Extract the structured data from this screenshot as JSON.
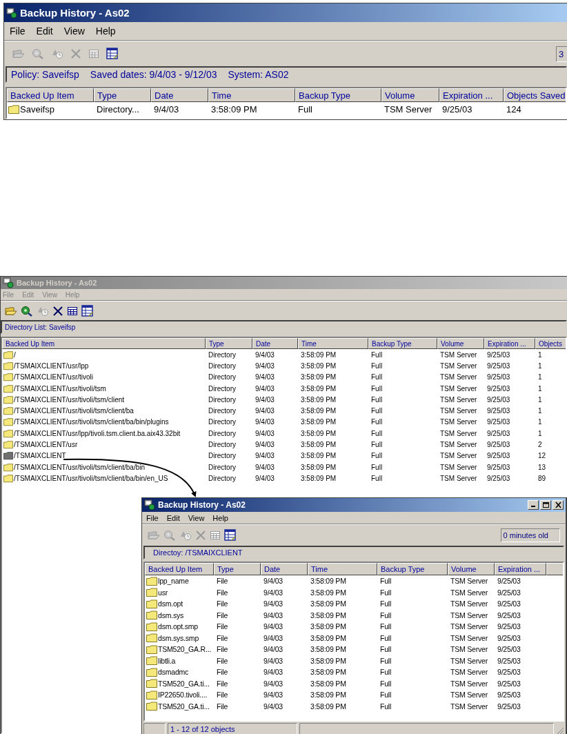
{
  "windows": [
    {
      "title": "Backup History - As02",
      "active": true,
      "has_controls": false,
      "menu": [
        "File",
        "Edit",
        "View",
        "Help"
      ],
      "toolbar": [
        {
          "kind": "open",
          "disabled": true
        },
        {
          "kind": "find",
          "disabled": true
        },
        {
          "kind": "schedule",
          "disabled": true
        },
        {
          "kind": "delete",
          "disabled": true
        },
        {
          "kind": "grid",
          "disabled": true
        },
        {
          "kind": "details",
          "disabled": false
        }
      ],
      "age_field": "3",
      "info": [
        "Policy: Saveifsp",
        "Saved dates: 9/4/03 - 9/12/03",
        "System: AS02"
      ],
      "columns": [
        "Backed Up Item",
        "Type",
        "Date",
        "Time",
        "Backup Type",
        "Volume",
        "Expiration ...",
        "Objects Saved"
      ],
      "rows": [
        {
          "selected": false,
          "cells": [
            "Saveifsp",
            "Directory...",
            "9/4/03",
            "3:58:09 PM",
            "Full",
            "TSM Server",
            "9/25/03",
            "124"
          ]
        }
      ]
    },
    {
      "title": "Backup History - As02",
      "active": false,
      "has_controls": false,
      "menu": [
        "File",
        "Edit",
        "View",
        "Help"
      ],
      "toolbar": [
        {
          "kind": "open",
          "disabled": false
        },
        {
          "kind": "find",
          "disabled": false
        },
        {
          "kind": "schedule",
          "disabled": true
        },
        {
          "kind": "delete",
          "disabled": false
        },
        {
          "kind": "grid",
          "disabled": false
        },
        {
          "kind": "details",
          "disabled": false
        }
      ],
      "info": [
        "Directory List: Saveifsp"
      ],
      "columns": [
        "Backed Up Item",
        "Type",
        "Date",
        "Time",
        "Backup Type",
        "Volume",
        "Expiration ...",
        "Objects"
      ],
      "rows": [
        {
          "selected": false,
          "cells": [
            "/",
            "Directory",
            "9/4/03",
            "3:58:09 PM",
            "Full",
            "TSM Server",
            "9/25/03",
            "1"
          ]
        },
        {
          "selected": false,
          "cells": [
            "/TSMAIXCLIENT/usr/lpp",
            "Directory",
            "9/4/03",
            "3:58:09 PM",
            "Full",
            "TSM Server",
            "9/25/03",
            "1"
          ]
        },
        {
          "selected": false,
          "cells": [
            "/TSMAIXCLIENT/usr/tivoli",
            "Directory",
            "9/4/03",
            "3:58:09 PM",
            "Full",
            "TSM Server",
            "9/25/03",
            "1"
          ]
        },
        {
          "selected": false,
          "cells": [
            "/TSMAIXCLIENT/usr/tivoli/tsm",
            "Directory",
            "9/4/03",
            "3:58:09 PM",
            "Full",
            "TSM Server",
            "9/25/03",
            "1"
          ]
        },
        {
          "selected": false,
          "cells": [
            "/TSMAIXCLIENT/usr/tivoli/tsm/client",
            "Directory",
            "9/4/03",
            "3:58:09 PM",
            "Full",
            "TSM Server",
            "9/25/03",
            "1"
          ]
        },
        {
          "selected": false,
          "cells": [
            "/TSMAIXCLIENT/usr/tivoli/tsm/client/ba",
            "Directory",
            "9/4/03",
            "3:58:09 PM",
            "Full",
            "TSM Server",
            "9/25/03",
            "1"
          ]
        },
        {
          "selected": false,
          "cells": [
            "/TSMAIXCLIENT/usr/tivoli/tsm/client/ba/bin/plugins",
            "Directory",
            "9/4/03",
            "3:58:09 PM",
            "Full",
            "TSM Server",
            "9/25/03",
            "1"
          ]
        },
        {
          "selected": false,
          "cells": [
            "/TSMAIXCLIENT/usr/lpp/tivoli.tsm.client.ba.aix43.32bit",
            "Directory",
            "9/4/03",
            "3:58:09 PM",
            "Full",
            "TSM Server",
            "9/25/03",
            "1"
          ]
        },
        {
          "selected": false,
          "cells": [
            "/TSMAIXCLIENT/usr",
            "Directory",
            "9/4/03",
            "3:58:09 PM",
            "Full",
            "TSM Server",
            "9/25/03",
            "2"
          ]
        },
        {
          "selected": true,
          "cells": [
            "/TSMAIXCLIENT",
            "Directory",
            "9/4/03",
            "3:58:09 PM",
            "Full",
            "TSM Server",
            "9/25/03",
            "12"
          ]
        },
        {
          "selected": false,
          "cells": [
            "/TSMAIXCLIENT/usr/tivoli/tsm/client/ba/bin",
            "Directory",
            "9/4/03",
            "3:58:09 PM",
            "Full",
            "TSM Server",
            "9/25/03",
            "13"
          ]
        },
        {
          "selected": false,
          "cells": [
            "/TSMAIXCLIENT/usr/tivoli/tsm/client/ba/bin/en_US",
            "Directory",
            "9/4/03",
            "3:58:09 PM",
            "Full",
            "TSM Server",
            "9/25/03",
            "89"
          ]
        }
      ]
    },
    {
      "title": "Backup History - As02",
      "active": true,
      "has_controls": true,
      "menu": [
        "File",
        "Edit",
        "View",
        "Help"
      ],
      "toolbar": [
        {
          "kind": "open",
          "disabled": true
        },
        {
          "kind": "find",
          "disabled": true
        },
        {
          "kind": "schedule",
          "disabled": true
        },
        {
          "kind": "delete",
          "disabled": true
        },
        {
          "kind": "grid",
          "disabled": true
        },
        {
          "kind": "details",
          "disabled": false
        }
      ],
      "age_field": "0 minutes old",
      "info": [
        "Directoy: /TSMAIXCLIENT"
      ],
      "columns": [
        "Backed Up Item",
        "Type",
        "Date",
        "Time",
        "Backup Type",
        "Volume",
        "Expiration ..."
      ],
      "rows": [
        {
          "selected": false,
          "cells": [
            "lpp_name",
            "File",
            "9/4/03",
            "3:58:09 PM",
            "Full",
            "TSM Server",
            "9/25/03"
          ]
        },
        {
          "selected": false,
          "cells": [
            "usr",
            "File",
            "9/4/03",
            "3:58:09 PM",
            "Full",
            "TSM Server",
            "9/25/03"
          ]
        },
        {
          "selected": false,
          "cells": [
            "dsm.opt",
            "File",
            "9/4/03",
            "3:58:09 PM",
            "Full",
            "TSM Server",
            "9/25/03"
          ]
        },
        {
          "selected": false,
          "cells": [
            "dsm.sys",
            "File",
            "9/4/03",
            "3:58:09 PM",
            "Full",
            "TSM Server",
            "9/25/03"
          ]
        },
        {
          "selected": false,
          "cells": [
            "dsm.opt.smp",
            "File",
            "9/4/03",
            "3:58:09 PM",
            "Full",
            "TSM Server",
            "9/25/03"
          ]
        },
        {
          "selected": false,
          "cells": [
            "dsm.sys.smp",
            "File",
            "9/4/03",
            "3:58:09 PM",
            "Full",
            "TSM Server",
            "9/25/03"
          ]
        },
        {
          "selected": false,
          "cells": [
            "TSM520_GA.R...",
            "File",
            "9/4/03",
            "3:58:09 PM",
            "Full",
            "TSM Server",
            "9/25/03"
          ]
        },
        {
          "selected": false,
          "cells": [
            "libtli.a",
            "File",
            "9/4/03",
            "3:58:09 PM",
            "Full",
            "TSM Server",
            "9/25/03"
          ]
        },
        {
          "selected": false,
          "cells": [
            "dsmadmc",
            "File",
            "9/4/03",
            "3:58:09 PM",
            "Full",
            "TSM Server",
            "9/25/03"
          ]
        },
        {
          "selected": false,
          "cells": [
            "TSM520_GA.ti...",
            "File",
            "9/4/03",
            "3:58:09 PM",
            "Full",
            "TSM Server",
            "9/25/03"
          ]
        },
        {
          "selected": false,
          "cells": [
            "IP22650.tivoli....",
            "File",
            "9/4/03",
            "3:58:09 PM",
            "Full",
            "TSM Server",
            "9/25/03"
          ]
        },
        {
          "selected": false,
          "cells": [
            "TSM520_GA.ti...",
            "File",
            "9/4/03",
            "3:58:09 PM",
            "Full",
            "TSM Server",
            "9/25/03"
          ]
        }
      ],
      "status": "1 - 12 of 12 objects"
    }
  ]
}
